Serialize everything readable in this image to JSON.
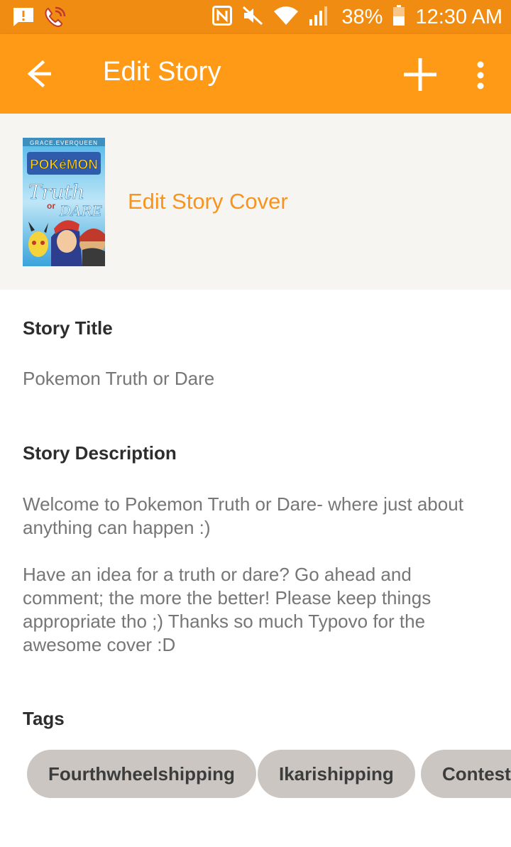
{
  "status_bar": {
    "battery_percent": "38%",
    "time": "12:30 AM",
    "icons": [
      "notification-icon",
      "missed-call-icon",
      "nfc-icon",
      "mute-icon",
      "wifi-icon",
      "signal-icon",
      "battery-icon"
    ]
  },
  "app_bar": {
    "title": "Edit Story",
    "icons": [
      "back-arrow-icon",
      "add-icon",
      "more-vert-icon"
    ],
    "color": "#ff9a17"
  },
  "cover": {
    "author_tag": "GRACE.EVERQUEEN",
    "logo_text": "POKéMON",
    "title_line1": "Truth",
    "title_line2": "or",
    "title_line3": "DARE",
    "edit_label": "Edit Story Cover"
  },
  "story_title": {
    "label": "Story Title",
    "value": "Pokemon Truth or Dare"
  },
  "story_description": {
    "label": "Story Description",
    "paragraph1": "Welcome to Pokemon Truth or Dare- where just about anything can happen :)",
    "paragraph2": "Have an idea for a truth or dare? Go ahead and comment; the more the better! Please keep things appropriate tho ;) Thanks so much Typovo for the awesome cover :D"
  },
  "tags": {
    "label": "Tags",
    "items": [
      "Fourthwheelshipping",
      "Ikarishipping",
      "Contestshipping"
    ]
  },
  "colors": {
    "accent": "#f7941d",
    "status_bar": "#f08c12",
    "chip": "#cbc6c1"
  }
}
